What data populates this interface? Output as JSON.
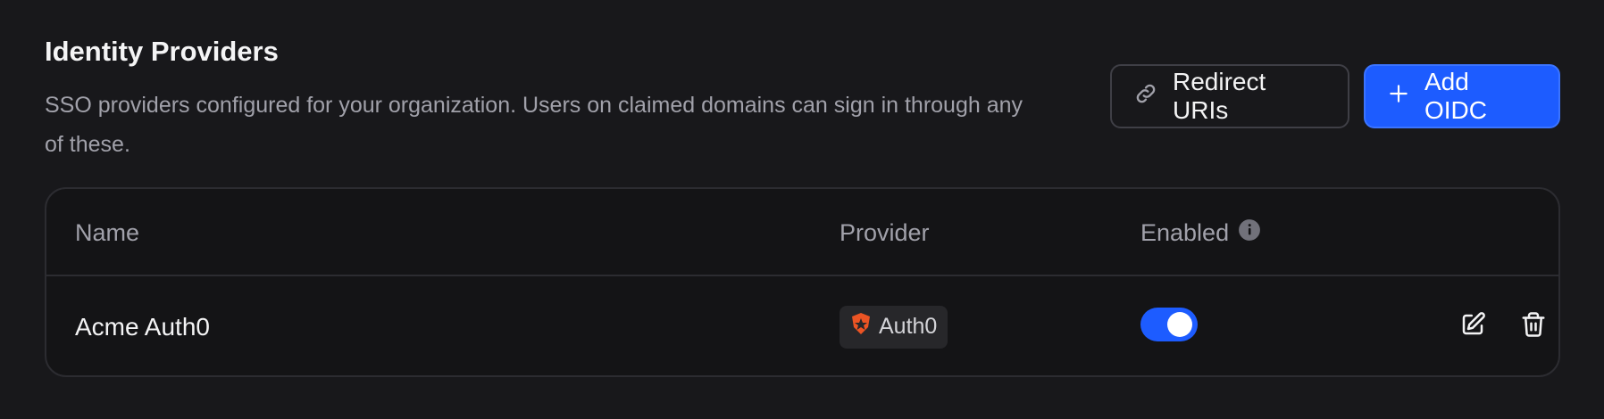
{
  "header": {
    "title": "Identity Providers",
    "description": "SSO providers configured for your organization. Users on claimed domains can sign in through any of these."
  },
  "actions": {
    "redirect_label": "Redirect URIs",
    "add_label": "Add OIDC"
  },
  "table": {
    "columns": [
      "Name",
      "Provider",
      "Enabled"
    ],
    "rows": [
      {
        "name": "Acme Auth0",
        "provider": "Auth0",
        "enabled": true
      }
    ]
  },
  "colors": {
    "background": "#18181b",
    "accent": "#1d5cff",
    "auth0_brand": "#eb5424"
  },
  "icons": {
    "redirect": "link-icon",
    "add": "plus-icon",
    "info": "info-icon",
    "provider": "auth0-logo-icon",
    "edit": "edit-icon",
    "delete": "trash-icon"
  }
}
